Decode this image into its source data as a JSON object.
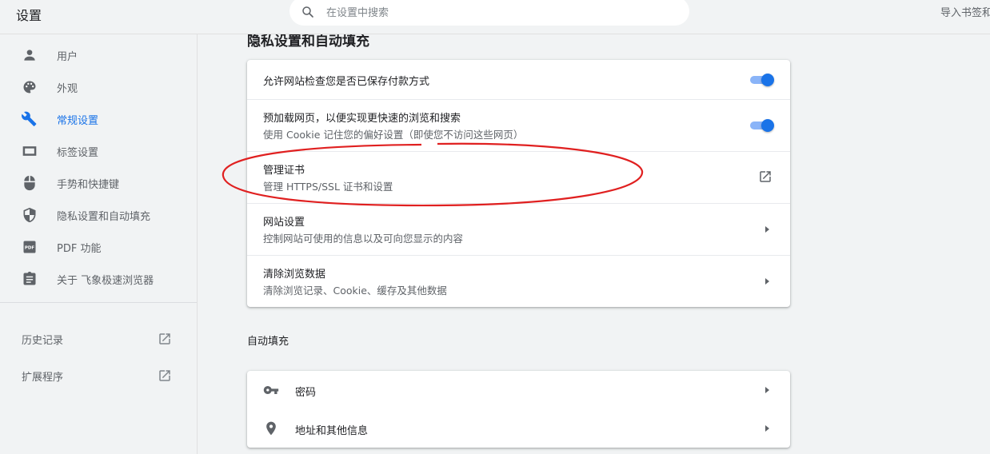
{
  "app": {
    "title": "设置",
    "search_placeholder": "在设置中搜索",
    "import_label": "导入书签和"
  },
  "sidebar": {
    "items": [
      {
        "label": "用户",
        "icon": "person-icon"
      },
      {
        "label": "外观",
        "icon": "palette-icon"
      },
      {
        "label": "常规设置",
        "icon": "wrench-icon",
        "active": true
      },
      {
        "label": "标签设置",
        "icon": "tab-icon"
      },
      {
        "label": "手势和快捷键",
        "icon": "mouse-icon"
      },
      {
        "label": "隐私设置和自动填充",
        "icon": "shield-icon"
      },
      {
        "label": "PDF 功能",
        "icon": "pdf-icon"
      },
      {
        "label": "关于 飞象极速浏览器",
        "icon": "clipboard-icon"
      }
    ],
    "external": [
      {
        "label": "历史记录",
        "icon": "open-in-new-icon"
      },
      {
        "label": "扩展程序",
        "icon": "open-in-new-icon"
      }
    ]
  },
  "privacy": {
    "section_title": "隐私设置和自动填充",
    "rows": [
      {
        "title": "允许网站检查您是否已保存付款方式",
        "subtitle": "",
        "control": "toggle",
        "checked": true
      },
      {
        "title": "预加载网页，以便实现更快速的浏览和搜索",
        "subtitle": "使用 Cookie 记住您的偏好设置（即使您不访问这些网页）",
        "control": "toggle",
        "checked": true
      },
      {
        "title": "管理证书",
        "subtitle": "管理 HTTPS/SSL 证书和设置",
        "control": "open-in-new-icon"
      },
      {
        "title": "网站设置",
        "subtitle": "控制网站可使用的信息以及可向您显示的内容",
        "control": "arrow-right-icon"
      },
      {
        "title": "清除浏览数据",
        "subtitle": "清除浏览记录、Cookie、缓存及其他数据",
        "control": "arrow-right-icon"
      }
    ]
  },
  "autofill": {
    "heading": "自动填充",
    "rows": [
      {
        "label": "密码",
        "icon": "key-icon"
      },
      {
        "label": "地址和其他信息",
        "icon": "location-pin-icon"
      }
    ]
  },
  "colors": {
    "accent": "#1a73e8",
    "toggle_track": "#8ab4f8",
    "annotation": "#e02020",
    "background": "#f1f3f4"
  }
}
